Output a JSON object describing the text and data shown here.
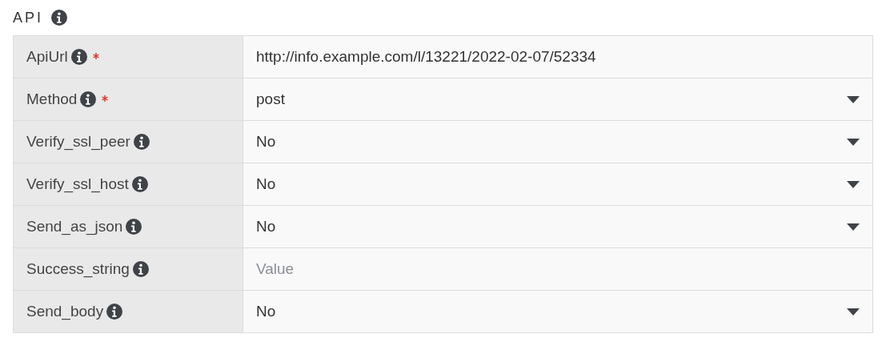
{
  "section": {
    "title": "API"
  },
  "fields": [
    {
      "label": "ApiUrl",
      "required": true,
      "kind": "text",
      "value": "http://info.example.com/l/13221/2022-02-07/52334"
    },
    {
      "label": "Method",
      "required": true,
      "kind": "select",
      "value": "post"
    },
    {
      "label": "Verify_ssl_peer",
      "required": false,
      "kind": "select",
      "value": "No"
    },
    {
      "label": "Verify_ssl_host",
      "required": false,
      "kind": "select",
      "value": "No"
    },
    {
      "label": "Send_as_json",
      "required": false,
      "kind": "select",
      "value": "No"
    },
    {
      "label": "Success_string",
      "required": false,
      "kind": "text",
      "placeholder": "Value"
    },
    {
      "label": "Send_body",
      "required": false,
      "kind": "select",
      "value": "No"
    }
  ]
}
